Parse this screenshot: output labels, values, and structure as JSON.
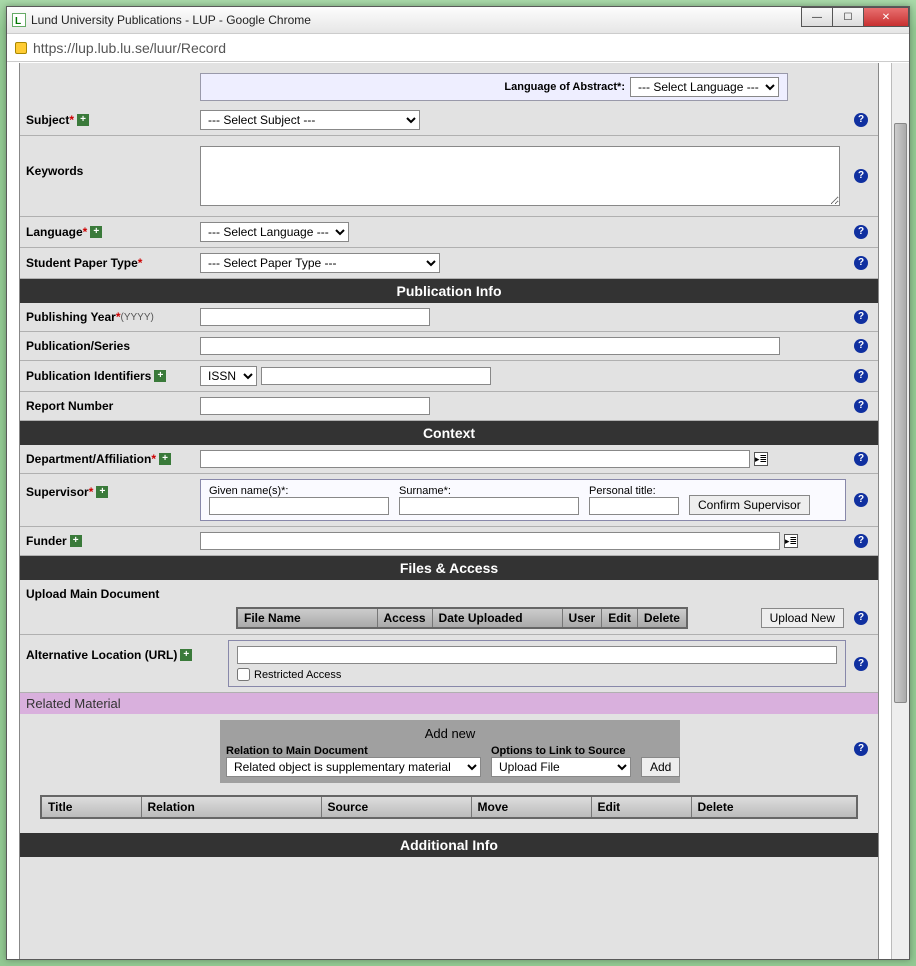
{
  "window": {
    "title": "Lund University Publications - LUP - Google Chrome"
  },
  "address": {
    "url": "https://lup.lub.lu.se/luur/Record"
  },
  "language_abstract": {
    "label": "Language of Abstract*:",
    "select": "--- Select Language ---"
  },
  "subject": {
    "label": "Subject",
    "select": "--- Select Subject ---"
  },
  "keywords": {
    "label": "Keywords",
    "value": ""
  },
  "language": {
    "label": "Language",
    "select": "--- Select Language ---"
  },
  "paper_type": {
    "label": "Student Paper Type",
    "select": "--- Select Paper Type ---"
  },
  "sections": {
    "pub_info": "Publication Info",
    "context": "Context",
    "files": "Files & Access",
    "additional": "Additional Info"
  },
  "pub_year": {
    "label": "Publishing Year",
    "hint": "(YYYY)",
    "value": ""
  },
  "pub_series": {
    "label": "Publication/Series",
    "value": ""
  },
  "pub_ids": {
    "label": "Publication Identifiers",
    "type": "ISSN",
    "value": ""
  },
  "report_no": {
    "label": "Report Number",
    "value": ""
  },
  "dept": {
    "label": "Department/Affiliation",
    "value": ""
  },
  "supervisor": {
    "label": "Supervisor",
    "given_label": "Given name(s)*:",
    "surname_label": "Surname*:",
    "title_label": "Personal title:",
    "confirm": "Confirm Supervisor"
  },
  "funder": {
    "label": "Funder",
    "value": ""
  },
  "upload_main": {
    "label": "Upload Main Document",
    "upload_btn": "Upload New"
  },
  "files_cols": {
    "fname": "File Name",
    "access": "Access",
    "date": "Date Uploaded",
    "user": "User",
    "edit": "Edit",
    "del": "Delete"
  },
  "alt_loc": {
    "label": "Alternative Location (URL)",
    "value": "",
    "restricted": "Restricted Access"
  },
  "related": {
    "header": "Related Material"
  },
  "addnew": {
    "title": "Add new",
    "rel_label": "Relation to Main Document",
    "rel_select": "Related object is supplementary material",
    "opt_label": "Options to Link to Source",
    "opt_select": "Upload File",
    "add_btn": "Add"
  },
  "rel_cols": {
    "title": "Title",
    "relation": "Relation",
    "source": "Source",
    "move": "Move",
    "edit": "Edit",
    "del": "Delete"
  }
}
